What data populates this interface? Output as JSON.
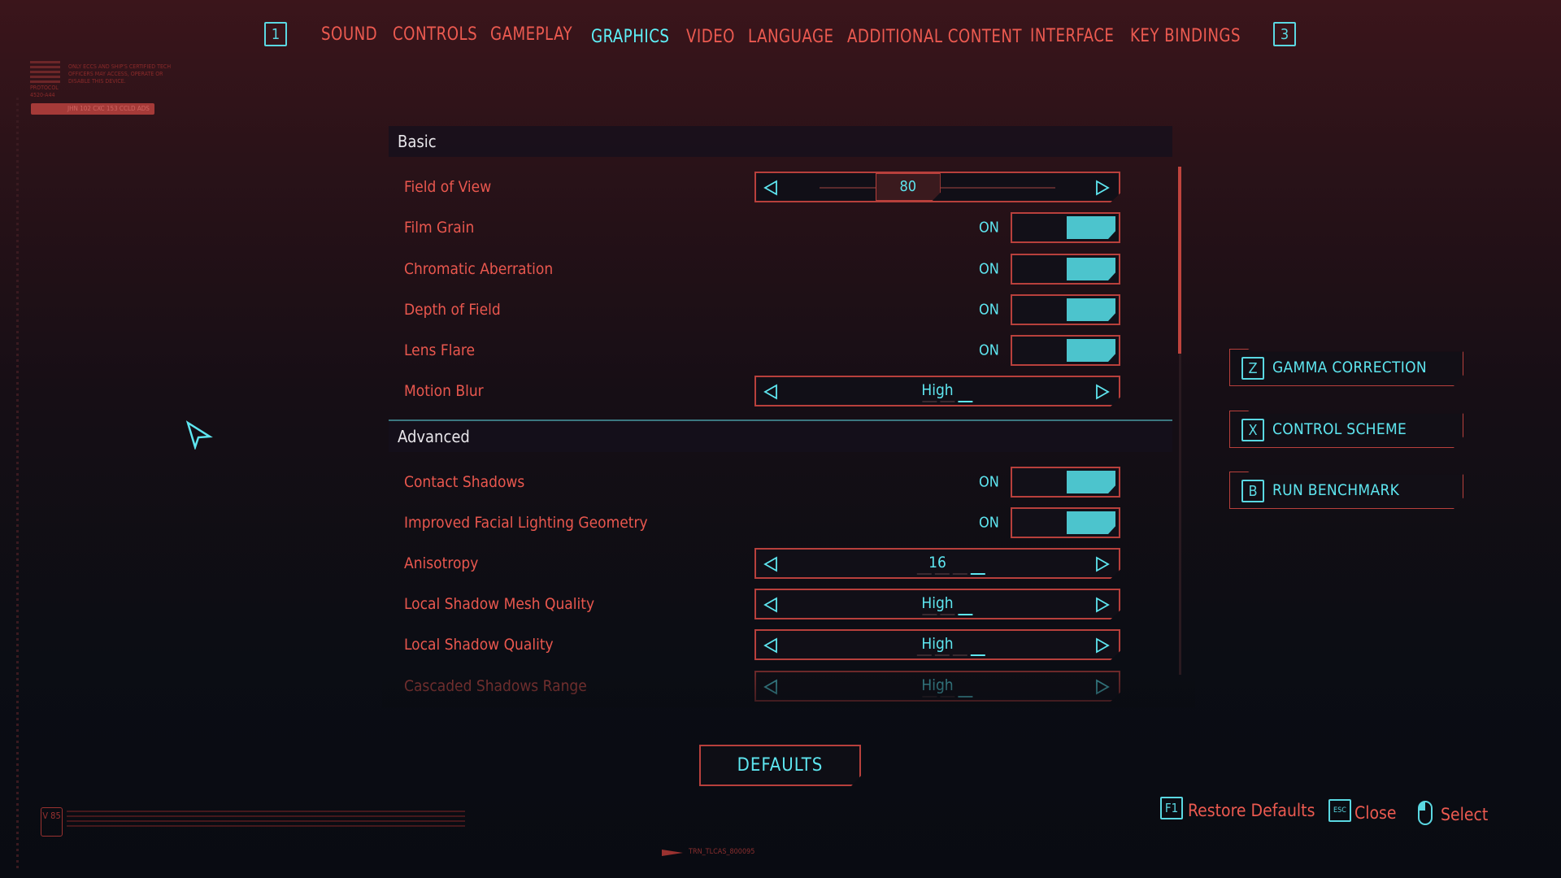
{
  "colors": {
    "accent_red": "#e9574e",
    "accent_cyan": "#5ee6f0",
    "toggle_fill": "#4cc4cd",
    "border": "#b8403c"
  },
  "nav": {
    "prev_key": "1",
    "next_key": "3",
    "tabs": [
      {
        "label": "SOUND",
        "active": false
      },
      {
        "label": "CONTROLS",
        "active": false
      },
      {
        "label": "GAMEPLAY",
        "active": false
      },
      {
        "label": "GRAPHICS",
        "active": true
      },
      {
        "label": "VIDEO",
        "active": false
      },
      {
        "label": "LANGUAGE",
        "active": false
      },
      {
        "label": "ADDITIONAL CONTENT",
        "active": false
      },
      {
        "label": "INTERFACE",
        "active": false
      },
      {
        "label": "KEY BINDINGS",
        "active": false
      }
    ]
  },
  "sections": {
    "basic": {
      "title": "Basic",
      "rows": [
        {
          "label": "Field of View",
          "type": "slider",
          "value": "80",
          "fill_fraction": 0.375
        },
        {
          "label": "Film Grain",
          "type": "toggle",
          "value": "ON"
        },
        {
          "label": "Chromatic Aberration",
          "type": "toggle",
          "value": "ON"
        },
        {
          "label": "Depth of Field",
          "type": "toggle",
          "value": "ON"
        },
        {
          "label": "Lens Flare",
          "type": "toggle",
          "value": "ON"
        },
        {
          "label": "Motion Blur",
          "type": "stepper",
          "value": "High",
          "option_count": 3,
          "option_index": 2
        }
      ]
    },
    "advanced": {
      "title": "Advanced",
      "rows": [
        {
          "label": "Contact Shadows",
          "type": "toggle",
          "value": "ON"
        },
        {
          "label": "Improved Facial Lighting Geometry",
          "type": "toggle",
          "value": "ON"
        },
        {
          "label": "Anisotropy",
          "type": "stepper",
          "value": "16",
          "option_count": 4,
          "option_index": 3
        },
        {
          "label": "Local Shadow Mesh Quality",
          "type": "stepper",
          "value": "High",
          "option_count": 3,
          "option_index": 2
        },
        {
          "label": "Local Shadow Quality",
          "type": "stepper",
          "value": "High",
          "option_count": 4,
          "option_index": 3
        },
        {
          "label": "Cascaded Shadows Range",
          "type": "stepper",
          "value": "High",
          "option_count": 3,
          "option_index": 2
        }
      ]
    }
  },
  "side_buttons": [
    {
      "key": "Z",
      "label": "GAMMA CORRECTION"
    },
    {
      "key": "X",
      "label": "CONTROL SCHEME"
    },
    {
      "key": "B",
      "label": "RUN BENCHMARK"
    }
  ],
  "defaults_button": "DEFAULTS",
  "footer": {
    "restore": {
      "key": "F1",
      "label": "Restore Defaults"
    },
    "close": {
      "key": "ESC",
      "label": "Close"
    },
    "select": {
      "label": "Select"
    }
  },
  "decor": {
    "code_tag": "TRN_TLCAS_800095",
    "badge": "V 85",
    "protocol": "PROTOCOL 4520-A44",
    "protocol_note": "ONLY ECCS AND SHIP'S CERTIFIED TECH OFFICERS MAY ACCESS, OPERATE OR DISABLE THIS DEVICE.",
    "red_strip": "JHN 102 CXC 153 CCLD ADS"
  }
}
